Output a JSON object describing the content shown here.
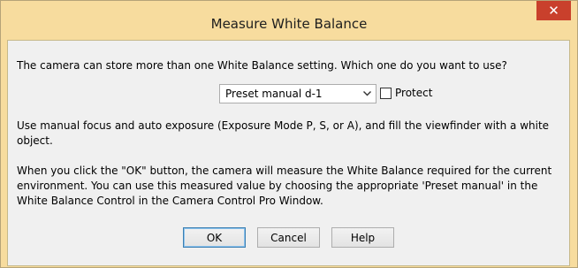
{
  "window": {
    "title": "Measure White Balance",
    "close_glyph": "✕"
  },
  "prompt": {
    "question": "The camera can store more than one White Balance setting.  Which one do you want to use?"
  },
  "preset_select": {
    "selected": "Preset manual d-1",
    "chevron_icon": "chevron-down-icon"
  },
  "protect_checkbox": {
    "label": "Protect",
    "checked": false
  },
  "instructions": {
    "focus_text": "Use manual focus and auto exposure (Exposure Mode P, S, or A), and fill the viewfinder with a white object.",
    "measure_text": "When you click the \"OK\" button, the camera will measure the White Balance required for the current environment. You can use this measured value by choosing the appropriate 'Preset manual' in the White Balance Control in the Camera Control Pro Window."
  },
  "buttons": {
    "ok": "OK",
    "cancel": "Cancel",
    "help": "Help"
  },
  "colors": {
    "titlebar": "#f7dc9e",
    "close_button": "#c9402c",
    "client_background": "#f0f0f0"
  }
}
